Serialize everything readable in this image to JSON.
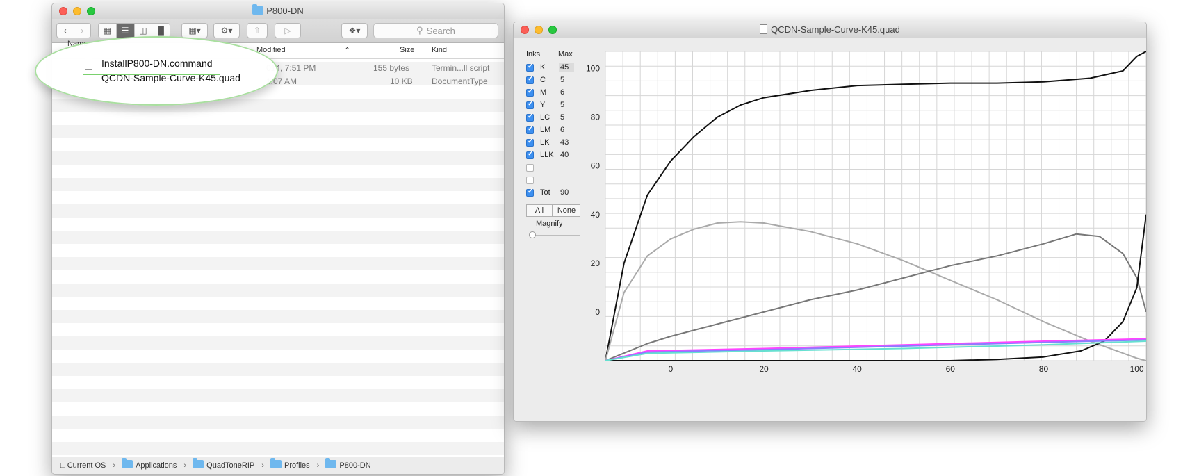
{
  "finder": {
    "title": "P800-DN",
    "search_placeholder": "Search",
    "columns": {
      "name": "Name",
      "modified": "Modified",
      "size": "Size",
      "kind": "Kind"
    },
    "files": [
      {
        "name": "InstallP800-DN.command",
        "modified": "2014, 7:51 PM",
        "modified_prefix": "014, 7:51 PM",
        "size": "155 bytes",
        "kind": "Termin...ll script"
      },
      {
        "name": "QCDN-Sample-Curve-K45.quad",
        "modified_prefix": "1:07 AM",
        "size": "10 KB",
        "kind": "DocumentType"
      }
    ],
    "breadcrumb": [
      "Current OS",
      "Applications",
      "QuadToneRIP",
      "Profiles",
      "P800-DN"
    ]
  },
  "curve_window": {
    "title": "QCDN-Sample-Curve-K45.quad",
    "panel": {
      "inks_header": "Inks",
      "max_header": "Max",
      "inks": [
        {
          "name": "K",
          "max": "45",
          "checked": true
        },
        {
          "name": "C",
          "max": "5",
          "checked": true
        },
        {
          "name": "M",
          "max": "6",
          "checked": true
        },
        {
          "name": "Y",
          "max": "5",
          "checked": true
        },
        {
          "name": "LC",
          "max": "5",
          "checked": true
        },
        {
          "name": "LM",
          "max": "6",
          "checked": true
        },
        {
          "name": "LK",
          "max": "43",
          "checked": true
        },
        {
          "name": "LLK",
          "max": "40",
          "checked": true
        },
        {
          "name": "",
          "max": "",
          "checked": false
        },
        {
          "name": "",
          "max": "",
          "checked": false
        },
        {
          "name": "Tot",
          "max": "90",
          "checked": true
        }
      ],
      "all_label": "All",
      "none_label": "None",
      "magnify_label": "Magnify"
    }
  },
  "chart_data": {
    "type": "line",
    "xlabel": "QCDN-Sample-Curve-K45",
    "x_ticks": [
      "0",
      "20",
      "40",
      "60",
      "80",
      "100"
    ],
    "y_ticks": [
      "100",
      "80",
      "60",
      "40",
      "20",
      "0"
    ],
    "grid": true,
    "series": [
      {
        "color": "#111111",
        "points": [
          [
            -14,
            -20
          ],
          [
            -10,
            20
          ],
          [
            -5,
            48
          ],
          [
            0,
            62
          ],
          [
            5,
            72
          ],
          [
            10,
            80
          ],
          [
            15,
            85
          ],
          [
            20,
            88
          ],
          [
            30,
            91
          ],
          [
            40,
            93
          ],
          [
            50,
            93.5
          ],
          [
            60,
            94
          ],
          [
            70,
            94
          ],
          [
            80,
            94.5
          ],
          [
            90,
            96
          ],
          [
            97,
            99
          ],
          [
            100,
            105
          ],
          [
            102,
            107
          ]
        ]
      },
      {
        "color": "#aaaaaa",
        "points": [
          [
            -14,
            -20
          ],
          [
            -10,
            8
          ],
          [
            -5,
            23
          ],
          [
            0,
            30
          ],
          [
            5,
            34
          ],
          [
            10,
            36.5
          ],
          [
            15,
            37
          ],
          [
            20,
            36.5
          ],
          [
            30,
            33
          ],
          [
            40,
            28
          ],
          [
            50,
            21
          ],
          [
            60,
            13
          ],
          [
            70,
            5
          ],
          [
            80,
            -4
          ],
          [
            90,
            -12
          ],
          [
            100,
            -19
          ],
          [
            102,
            -20
          ]
        ]
      },
      {
        "color": "#777777",
        "points": [
          [
            -14,
            -20
          ],
          [
            -5,
            -13
          ],
          [
            0,
            -10
          ],
          [
            10,
            -5
          ],
          [
            20,
            0
          ],
          [
            30,
            5
          ],
          [
            40,
            9
          ],
          [
            50,
            14
          ],
          [
            60,
            19
          ],
          [
            70,
            23
          ],
          [
            80,
            28
          ],
          [
            87,
            32
          ],
          [
            92,
            31
          ],
          [
            97,
            24
          ],
          [
            100,
            14
          ],
          [
            102,
            0
          ]
        ]
      },
      {
        "color": "#111111",
        "points": [
          [
            -14,
            -20
          ],
          [
            60,
            -20
          ],
          [
            70,
            -19.5
          ],
          [
            80,
            -18.5
          ],
          [
            88,
            -16
          ],
          [
            93,
            -12
          ],
          [
            97,
            -4
          ],
          [
            100,
            10
          ],
          [
            102,
            40
          ]
        ]
      },
      {
        "color": "#ff44ff",
        "points": [
          [
            -14,
            -20
          ],
          [
            -5,
            -16
          ],
          [
            20,
            -15
          ],
          [
            50,
            -13.5
          ],
          [
            80,
            -12
          ],
          [
            102,
            -11
          ]
        ]
      },
      {
        "color": "#8a7dff",
        "points": [
          [
            -14,
            -20
          ],
          [
            -5,
            -16.5
          ],
          [
            20,
            -15.5
          ],
          [
            50,
            -14
          ],
          [
            80,
            -12.5
          ],
          [
            102,
            -11.5
          ]
        ]
      },
      {
        "color": "#66e0d0",
        "points": [
          [
            -14,
            -20
          ],
          [
            -5,
            -17
          ],
          [
            20,
            -16
          ],
          [
            50,
            -15
          ],
          [
            80,
            -13.5
          ],
          [
            102,
            -12
          ]
        ]
      }
    ]
  }
}
